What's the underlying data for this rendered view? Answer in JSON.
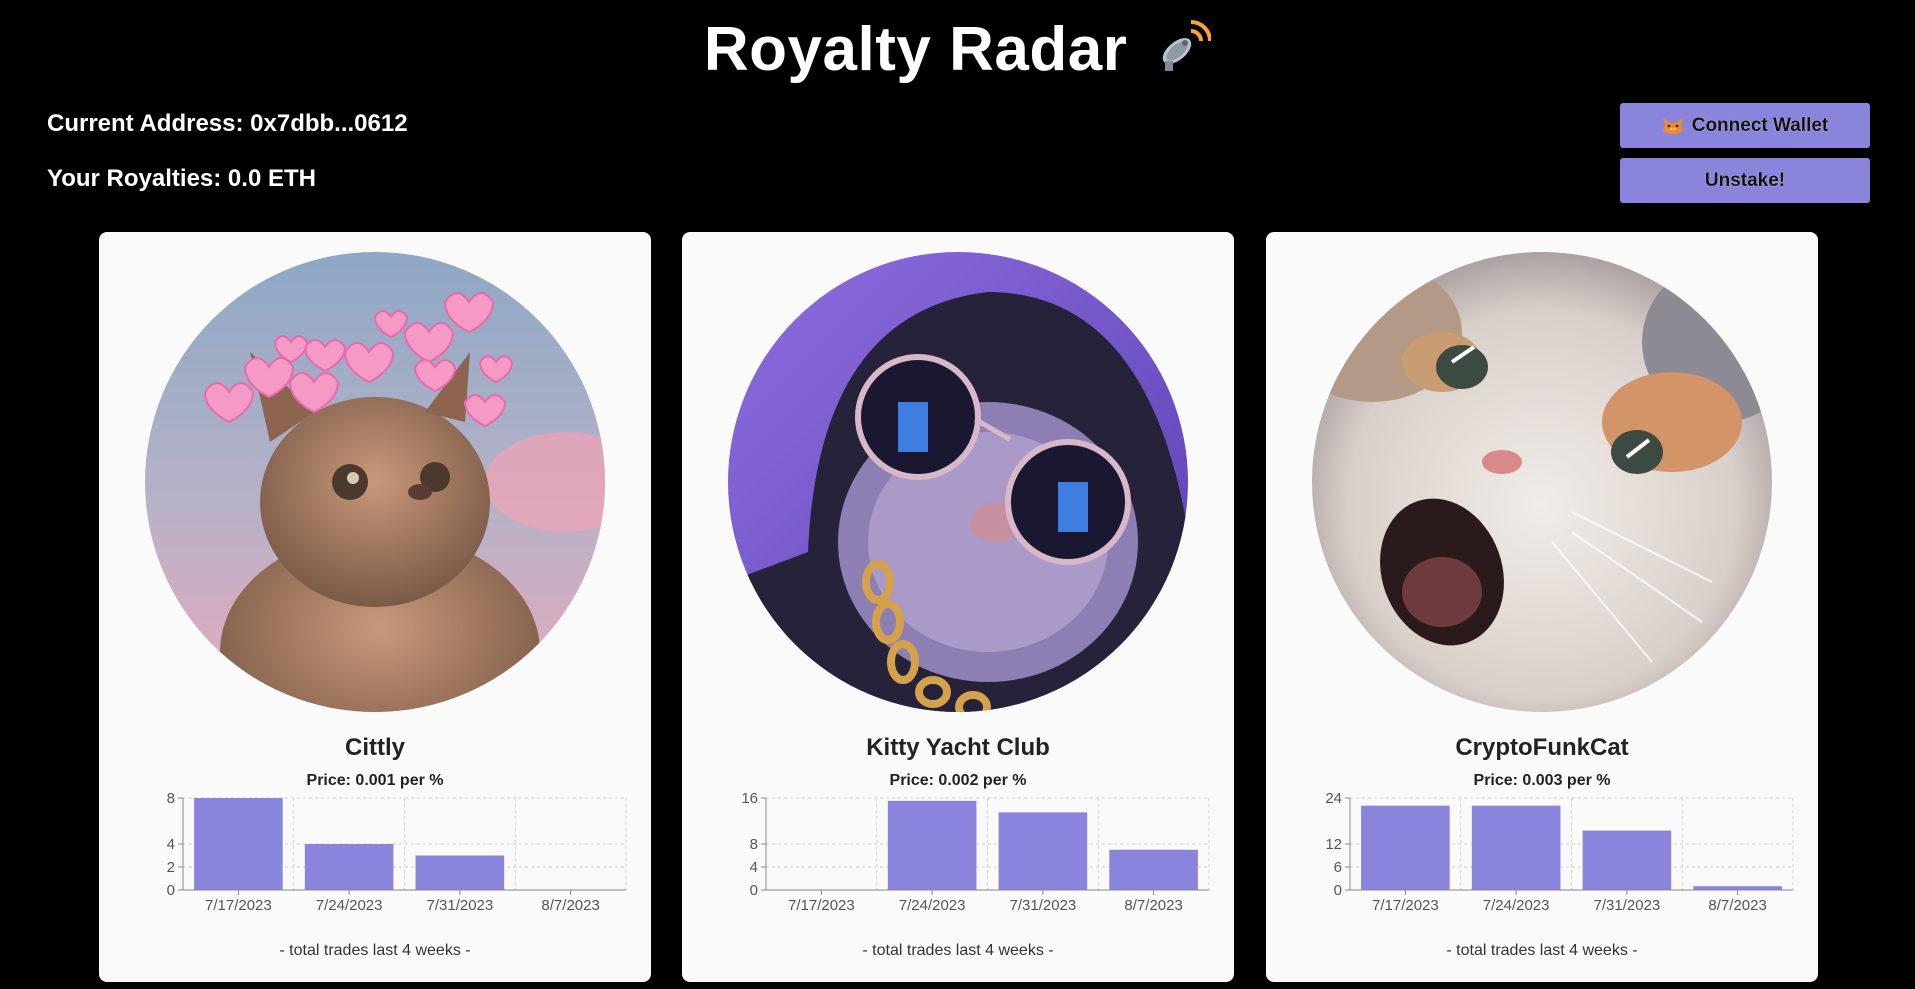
{
  "header": {
    "title": "Royalty Radar",
    "title_icon": "satellite-dish-icon"
  },
  "account": {
    "address_label": "Current Address: 0x7dbb...0612",
    "royalties_label": "Your Royalties: 0.0 ETH"
  },
  "buttons": {
    "connect_wallet": "Connect Wallet",
    "connect_icon": "metamask-fox-icon",
    "unstake": "Unstake!"
  },
  "colors": {
    "accent": "#8a84dc",
    "background": "#000000",
    "card": "#fafafa"
  },
  "cards": [
    {
      "name": "Cittly",
      "price": "Price: 0.001 per %",
      "caption": "- total trades last 4 weeks -",
      "image": "cat-with-hearts-image"
    },
    {
      "name": "Kitty Yacht Club",
      "price": "Price: 0.002 per %",
      "caption": "- total trades last 4 weeks -",
      "image": "cat-with-sunglasses-image"
    },
    {
      "name": "CryptoFunkCat",
      "price": "Price: 0.003 per %",
      "caption": "- total trades last 4 weeks -",
      "image": "screaming-cat-image"
    }
  ],
  "chart_data": [
    {
      "type": "bar",
      "categories": [
        "7/17/2023",
        "7/24/2023",
        "7/31/2023",
        "8/7/2023"
      ],
      "values": [
        8,
        4,
        3,
        0
      ],
      "yticks": [
        0,
        2,
        4,
        8
      ],
      "ylim": [
        0,
        8
      ],
      "grid": true
    },
    {
      "type": "bar",
      "categories": [
        "7/17/2023",
        "7/24/2023",
        "7/31/2023",
        "8/7/2023"
      ],
      "values": [
        0,
        15.5,
        13.5,
        7
      ],
      "yticks": [
        0,
        4,
        8,
        16
      ],
      "ylim": [
        0,
        16
      ],
      "grid": true
    },
    {
      "type": "bar",
      "categories": [
        "7/17/2023",
        "7/24/2023",
        "7/31/2023",
        "8/7/2023"
      ],
      "values": [
        22,
        22,
        15.5,
        1
      ],
      "yticks": [
        0,
        6,
        12,
        24
      ],
      "ylim": [
        0,
        24
      ],
      "grid": true
    }
  ]
}
